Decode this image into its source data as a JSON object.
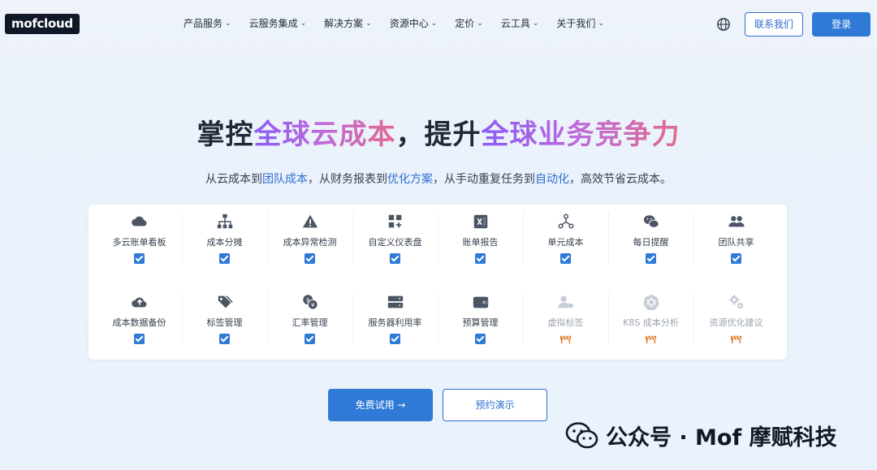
{
  "logo": "mofcloud",
  "nav": {
    "items": [
      "产品服务",
      "云服务集成",
      "解决方案",
      "资源中心",
      "定价",
      "云工具",
      "关于我们"
    ],
    "contact": "联系我们",
    "login": "登录"
  },
  "hero": {
    "title_a": "掌控",
    "title_b": "全球云成本",
    "title_c": "，提升",
    "title_d": "全球业务竞争力",
    "sub_1": "从云成本到",
    "sub_2": "团队成本",
    "sub_3": "，从财务报表到",
    "sub_4": "优化方案",
    "sub_5": "，从手动重复任务到",
    "sub_6": "自动化",
    "sub_7": "，高效节省云成本。"
  },
  "features": {
    "row1": [
      {
        "label": "多云账单看板",
        "icon": "cloud-icon",
        "status": "checked"
      },
      {
        "label": "成本分摊",
        "icon": "sitemap-icon",
        "status": "checked"
      },
      {
        "label": "成本异常检测",
        "icon": "warning-icon",
        "status": "checked"
      },
      {
        "label": "自定义仪表盘",
        "icon": "dashboard-add-icon",
        "status": "checked"
      },
      {
        "label": "账单报告",
        "icon": "excel-icon",
        "status": "checked"
      },
      {
        "label": "单元成本",
        "icon": "nodes-icon",
        "status": "checked"
      },
      {
        "label": "每日提醒",
        "icon": "wechat-icon",
        "status": "checked"
      },
      {
        "label": "团队共享",
        "icon": "users-icon",
        "status": "checked"
      }
    ],
    "row2": [
      {
        "label": "成本数据备份",
        "icon": "cloud-upload-icon",
        "status": "checked"
      },
      {
        "label": "标签管理",
        "icon": "tags-icon",
        "status": "checked"
      },
      {
        "label": "汇率管理",
        "icon": "coins-icon",
        "status": "checked"
      },
      {
        "label": "服务器利用率",
        "icon": "server-icon",
        "status": "checked"
      },
      {
        "label": "预算管理",
        "icon": "wallet-icon",
        "status": "checked"
      },
      {
        "label": "虚拟标签",
        "icon": "user-tag-icon",
        "status": "coming-soon"
      },
      {
        "label": "K8S 成本分析",
        "icon": "kubernetes-icon",
        "status": "coming-soon"
      },
      {
        "label": "资源优化建议",
        "icon": "gears-icon",
        "status": "coming-soon"
      }
    ]
  },
  "cta": {
    "trial": "免费试用 →",
    "demo": "预约演示"
  },
  "watermark": "公众号 · Mof 摩赋科技",
  "colors": {
    "accent": "#2f7ad6",
    "icon": "#4b5563",
    "dim": "#c7cdd6",
    "barrier": "#e07b2a"
  }
}
